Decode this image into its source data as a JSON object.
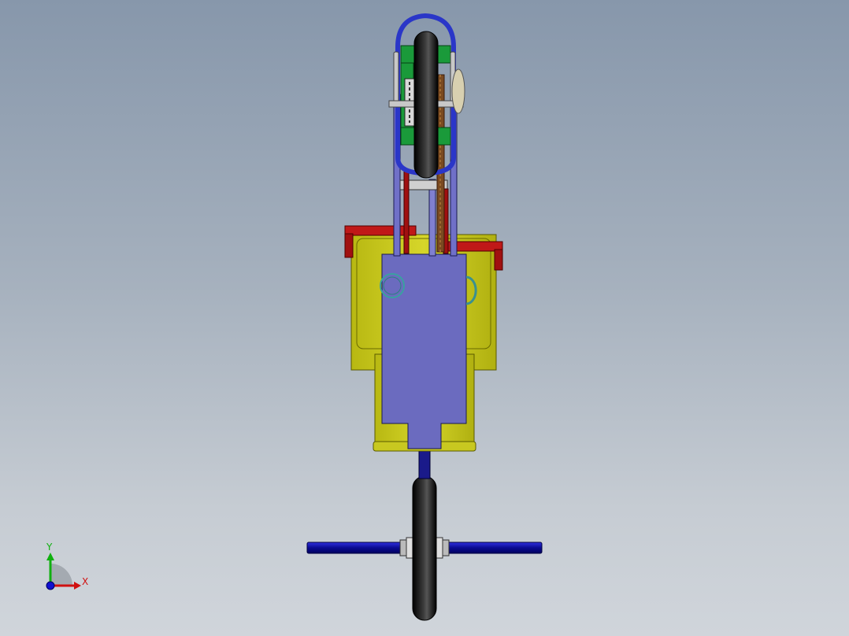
{
  "viewport": {
    "background_top": "#8797ab",
    "background_bottom": "#d0d5db"
  },
  "model": {
    "colors": {
      "frame": "#6b6bbf",
      "seat": "#c8c820",
      "tire": "#141414",
      "bracket": "#a01010",
      "steering_bar": "#0a0aa0",
      "chain": "#6b3a1a",
      "green_part": "#1a9a3a",
      "blue_loop": "#2030c0"
    }
  },
  "triad": {
    "y_label": "Y",
    "x_label": "X",
    "y_color": "#10b010",
    "x_color": "#d01010",
    "z_color": "#1010d0"
  }
}
